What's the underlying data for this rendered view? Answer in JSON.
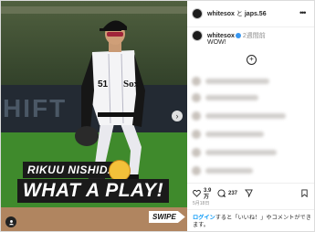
{
  "media": {
    "wall_text": "HIFT",
    "jersey_text": "Sox",
    "jersey_number": "51",
    "overlay_line1": "RIKUU NISHIDA!",
    "overlay_line2": "WHAT A PLAY!",
    "swipe_label": "SWIPE"
  },
  "header": {
    "username": "whitesox",
    "separator": "と",
    "collab": "japs.56",
    "more": "•••"
  },
  "caption": {
    "username": "whitesox",
    "date": "2週間前",
    "text": "WOW!"
  },
  "comments_blurred": 6,
  "actions": {
    "likes": "3.9",
    "likes_unit": "万",
    "comments": "237"
  },
  "post_date": "5月18日",
  "login": {
    "link_text": "ログイン",
    "rest_text": "すると「いいね！」やコメントができます。"
  },
  "colors": {
    "link": "#0095f6",
    "verified": "#3897f0",
    "grass": "#3f8a2c"
  }
}
